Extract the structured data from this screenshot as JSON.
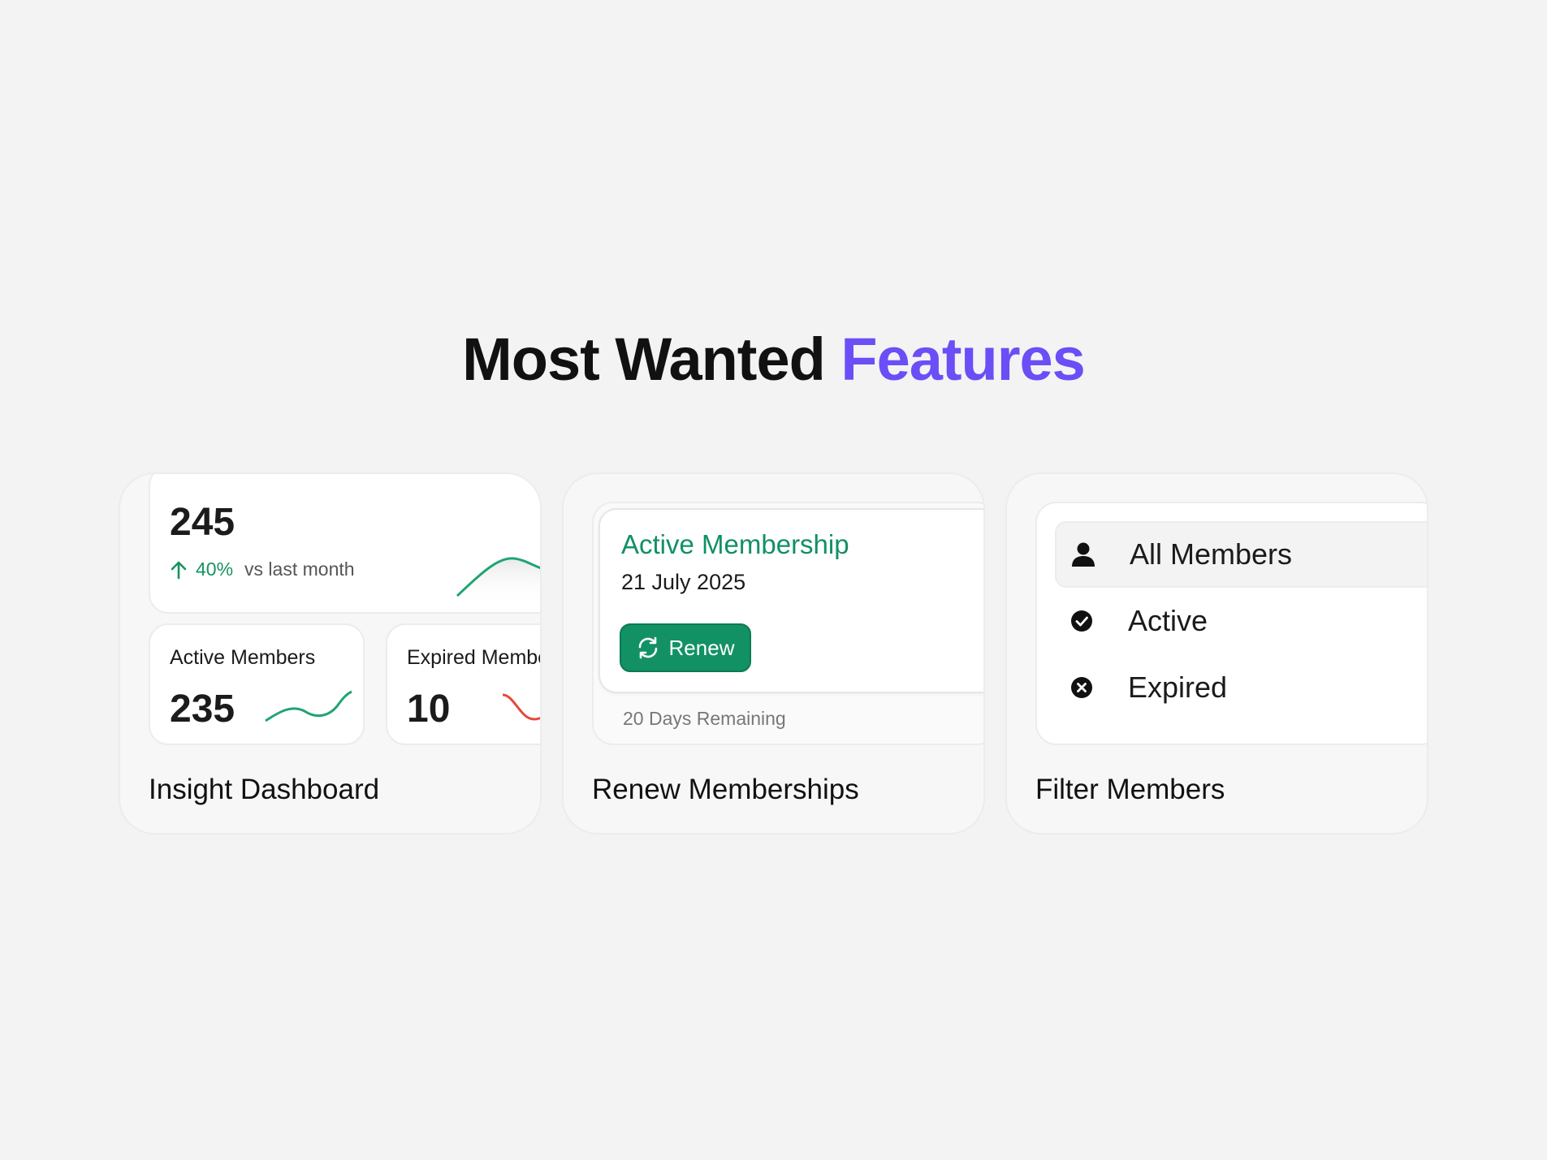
{
  "headline": {
    "part1": "Most Wanted",
    "part2": "Features",
    "accent_color": "#6b4ef6"
  },
  "cards": {
    "insight": {
      "title": "Insight Dashboard",
      "total": "245",
      "change": "40%",
      "change_suffix": "vs last month",
      "active": {
        "label": "Active Members",
        "value": "235",
        "trend_color": "#16935f"
      },
      "expired": {
        "label": "Expired Members",
        "value": "10",
        "trend_color": "#e5483a"
      }
    },
    "renew": {
      "title": "Renew Memberships",
      "status": "Active Membership",
      "date": "21 July 2025",
      "button": "Renew",
      "remaining": "20 Days Remaining",
      "brand_color": "#129165"
    },
    "filter": {
      "title": "Filter Members",
      "items": [
        {
          "label": "All Members",
          "icon": "user-icon",
          "selected": true
        },
        {
          "label": "Active",
          "icon": "check-circle-icon",
          "selected": false
        },
        {
          "label": "Expired",
          "icon": "x-circle-icon",
          "selected": false
        }
      ]
    }
  }
}
